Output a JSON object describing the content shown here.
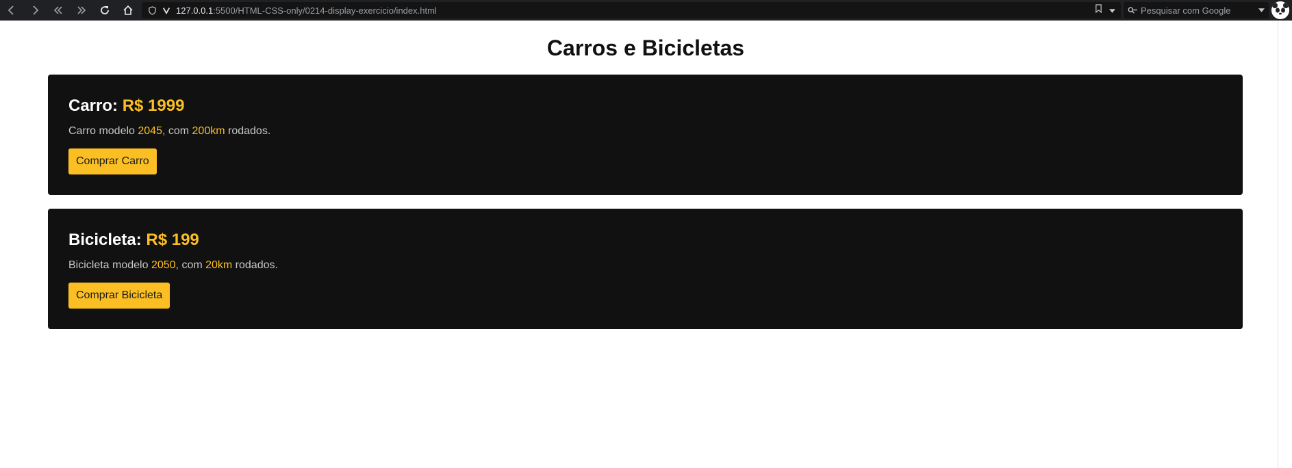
{
  "browser": {
    "url_host": "127.0.0.1",
    "url_rest": ":5500/HTML-CSS-only/0214-display-exercicio/index.html",
    "search_placeholder": "Pesquisar com Google"
  },
  "page": {
    "title": "Carros e Bicicletas"
  },
  "cards": [
    {
      "heading": "Carro:",
      "price": "R$ 1999",
      "desc_prefix": "Carro modelo ",
      "model": "2045",
      "desc_mid": ", com ",
      "distance": "200km",
      "desc_suffix": " rodados.",
      "button": "Comprar Carro"
    },
    {
      "heading": "Bicicleta:",
      "price": "R$ 199",
      "desc_prefix": "Bicicleta modelo ",
      "model": "2050",
      "desc_mid": ", com ",
      "distance": "20km",
      "desc_suffix": " rodados.",
      "button": "Comprar Bicicleta"
    }
  ],
  "colors": {
    "accent": "#fbbf24",
    "card_bg": "#111111",
    "chrome_bg": "#202124"
  }
}
